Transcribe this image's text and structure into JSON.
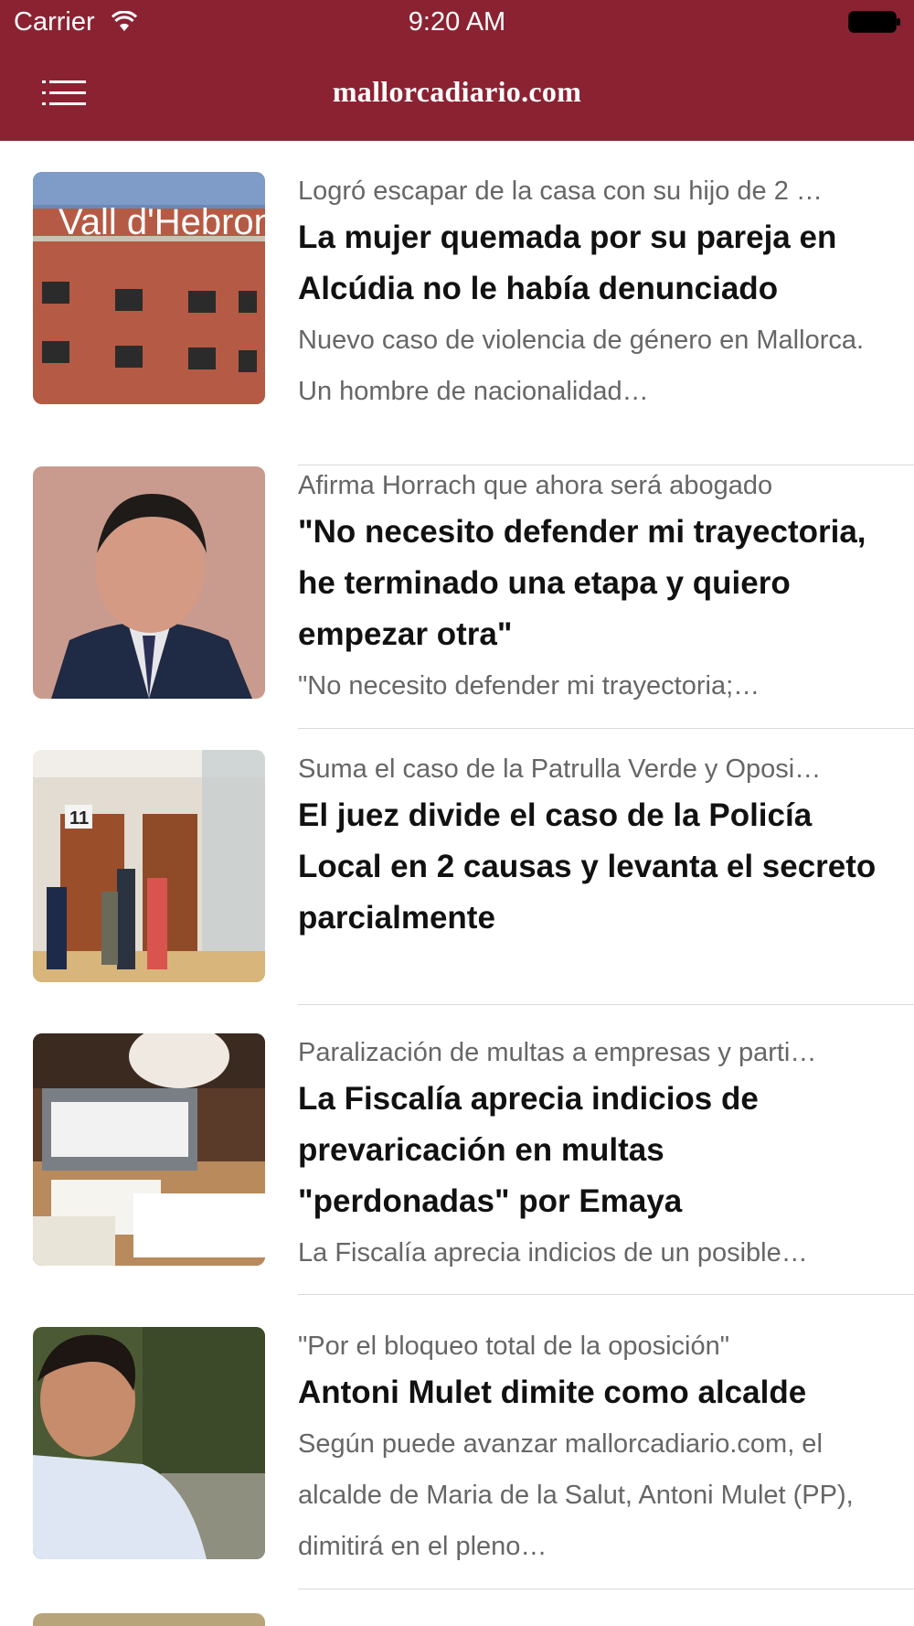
{
  "status_bar": {
    "carrier": "Carrier",
    "time": "9:20 AM",
    "wifi_icon": "wifi-icon",
    "battery_icon": "battery-icon"
  },
  "navbar": {
    "title": "mallorcadiario.com",
    "menu_icon": "list-menu-icon",
    "background_color": "#8b2232"
  },
  "articles": [
    {
      "kicker": "Logró escapar de la casa con su hijo de 2 …",
      "headline": "La mujer quemada por su pareja en Alcúdia no le había denunciado",
      "summary": "Nuevo caso de violencia de género en Mallorca. Un hombre de nacionalidad…"
    },
    {
      "kicker": "Afirma Horrach que ahora será abogado",
      "headline": "\"No necesito defender mi trayectoria, he terminado una etapa y quiero empezar otra\"",
      "summary": "\"No necesito defender mi trayectoria;…"
    },
    {
      "kicker": "Suma el caso de la Patrulla Verde y Oposi…",
      "headline": "El juez divide el caso de la Policía Local en 2 causas y levanta el secreto parcialmente",
      "summary": ""
    },
    {
      "kicker": "Paralización de multas a empresas y parti…",
      "headline": "La Fiscalía aprecia indicios de prevaricación en multas \"perdonadas\" por Emaya",
      "summary": "La Fiscalía aprecia indicios de un posible…"
    },
    {
      "kicker": "\"Por el bloqueo total de la oposición\"",
      "headline": "Antoni Mulet dimite como alcalde",
      "summary": "Según puede avanzar mallorcadiario.com, el alcalde de Maria de la Salut, Antoni Mulet (PP), dimitirá en el pleno…"
    }
  ],
  "thumbnails": {
    "article_1_sign": "Vall d'Hebron",
    "article_3_door_number": "11"
  }
}
